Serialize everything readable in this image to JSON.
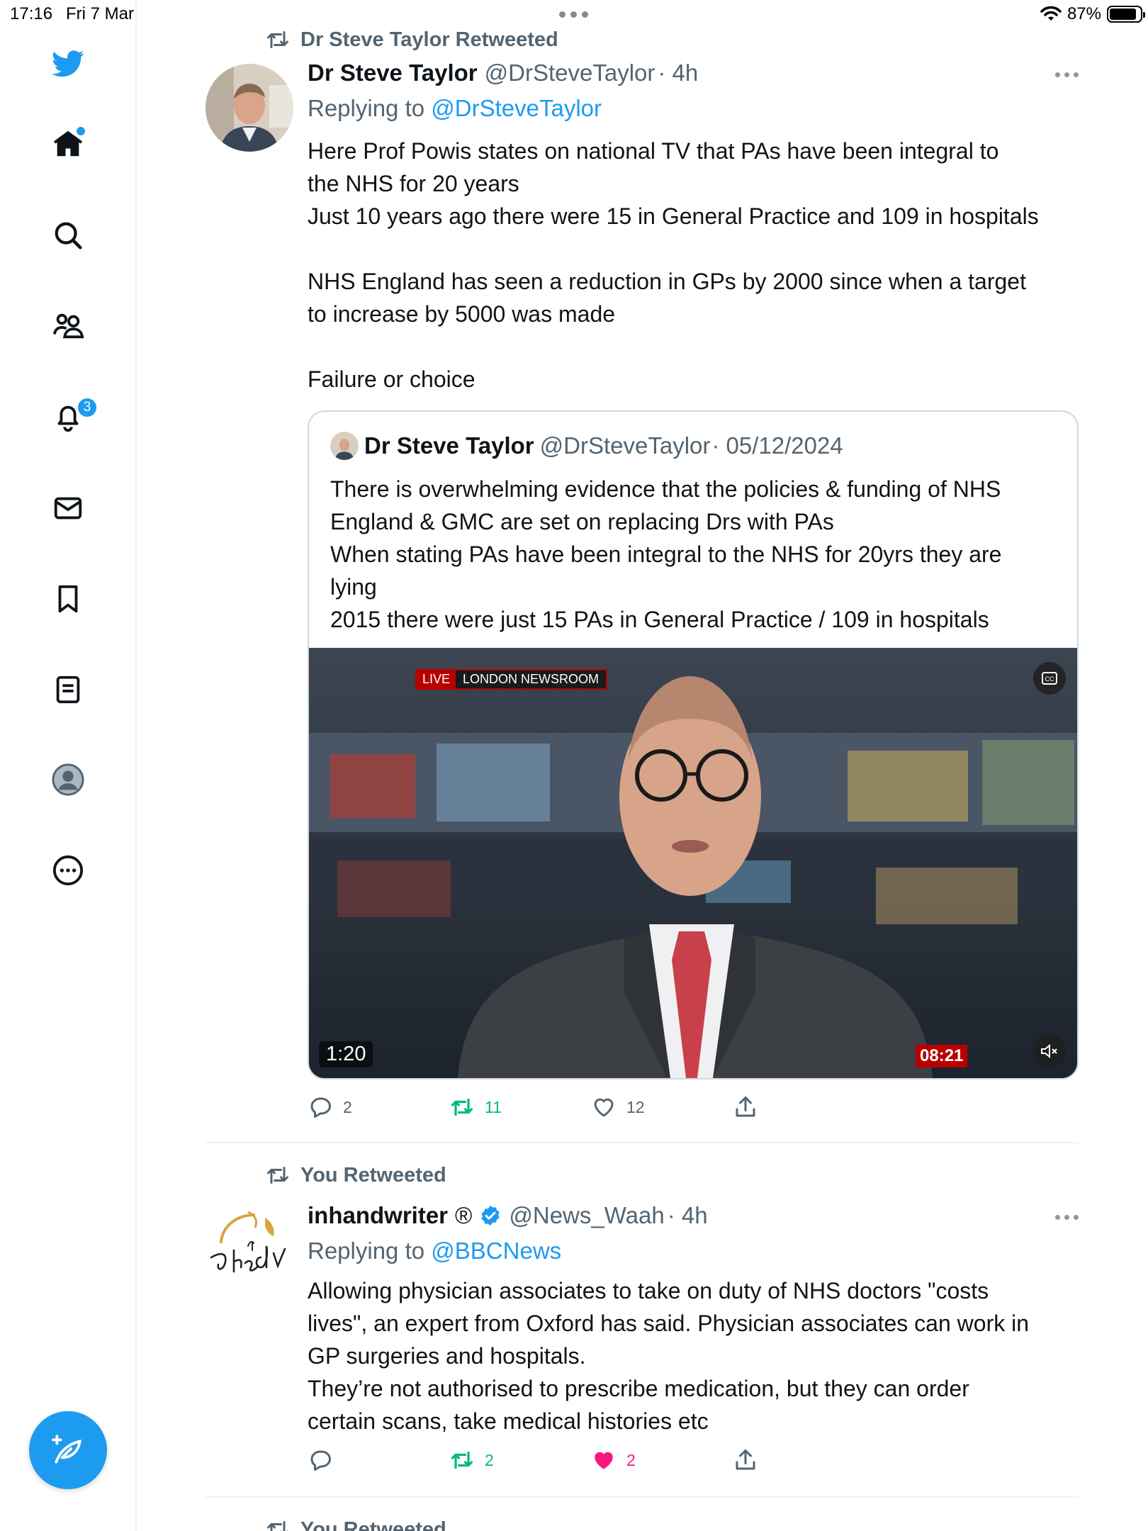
{
  "status_bar": {
    "time": "17:16",
    "date": "Fri 7 Mar",
    "battery": "87%",
    "battery_level": 0.87
  },
  "sidebar": {
    "accent": "#1d9bf0",
    "notifications_count": "3"
  },
  "tweets": [
    {
      "retweet_label": "Dr Steve Taylor Retweeted",
      "name": "Dr Steve Taylor",
      "handle": "@DrSteveTaylor",
      "time": "· 4h",
      "replying_prefix": "Replying to",
      "replying_to": "@DrSteveTaylor",
      "body": [
        "Here Prof Powis states on national TV that PAs have been integral to",
        "the NHS for 20 years",
        "Just 10 years ago there were 15 in General Practice and 109 in hospitals",
        "",
        "NHS England has seen a reduction in GPs by 2000 since when a target",
        "to increase by 5000 was made",
        "",
        "Failure or choice"
      ],
      "quote": {
        "name": "Dr Steve Taylor",
        "handle": "@DrSteveTaylor",
        "date": "· 05/12/2024",
        "body": [
          "There is overwhelming evidence that the policies & funding of NHS",
          "England & GMC are set on replacing Drs with PAs",
          "When stating PAs have been integral to the NHS for 20yrs they are",
          "lying",
          "2015 there were just 15 PAs in General Practice / 109 in hospitals"
        ],
        "video": {
          "live_label": "LIVE",
          "room_label": "LONDON NEWSROOM",
          "duration": "1:20",
          "clock": "08:21"
        }
      },
      "actions": {
        "replies": "2",
        "retweets": "11",
        "likes": "12"
      }
    },
    {
      "retweet_label": "You Retweeted",
      "name": "inhandwriter",
      "registered_mark": "®",
      "handle": "@News_Waah",
      "time": "· 4h",
      "replying_prefix": "Replying to",
      "replying_to": "@BBCNews",
      "body": [
        "Allowing physician associates to take on duty of NHS doctors \"costs",
        "lives\", an expert from Oxford has said. Physician associates can work in",
        "GP surgeries and hospitals.",
        "They’re not authorised to prescribe medication, but they can order",
        "certain scans, take medical histories etc"
      ],
      "actions": {
        "replies": "",
        "retweets": "2",
        "likes": "2"
      }
    },
    {
      "retweet_label": "You Retweeted"
    }
  ]
}
